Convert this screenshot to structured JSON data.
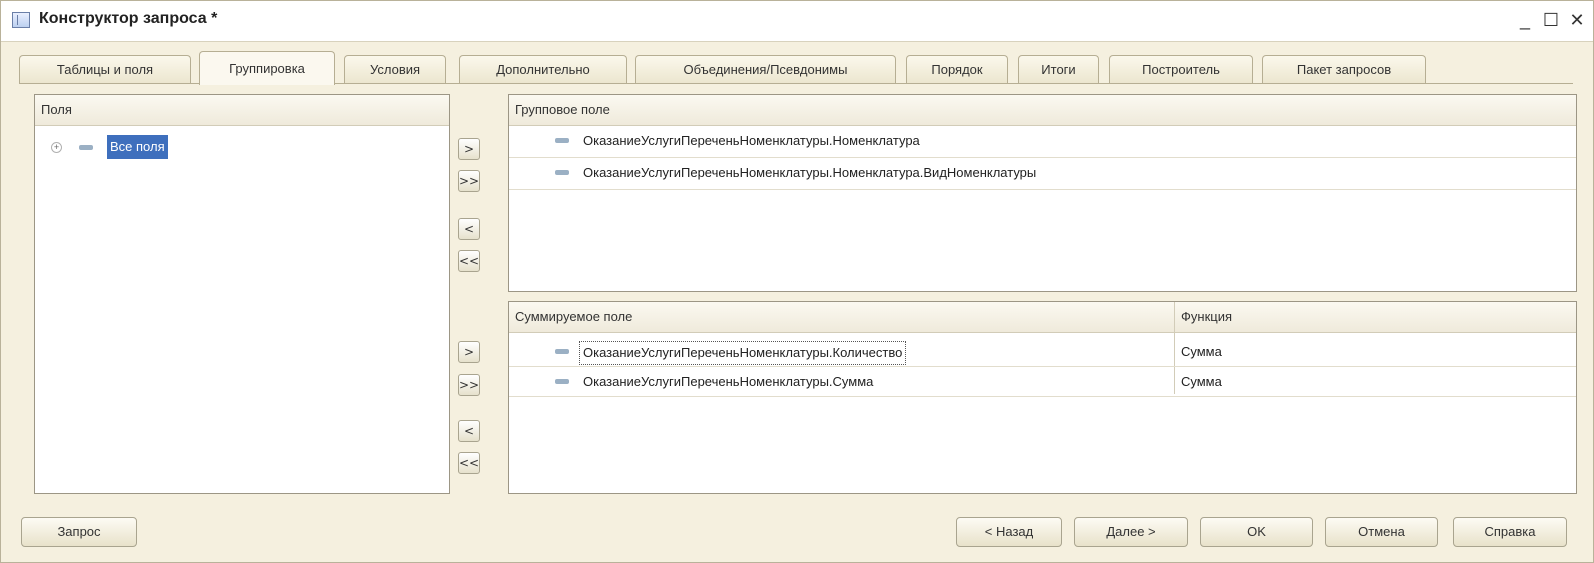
{
  "window": {
    "title": "Конструктор запроса *",
    "minimize_label": "_",
    "maximize_label": "☐",
    "close_label": "✕"
  },
  "tabs": [
    {
      "label": "Таблицы и поля"
    },
    {
      "label": "Группировка",
      "active": true
    },
    {
      "label": "Условия"
    },
    {
      "label": "Дополнительно"
    },
    {
      "label": "Объединения/Псевдонимы"
    },
    {
      "label": "Порядок"
    },
    {
      "label": "Итоги"
    },
    {
      "label": "Построитель"
    },
    {
      "label": "Пакет запросов"
    }
  ],
  "fields_panel": {
    "header": "Поля",
    "tree": [
      {
        "label": "Все поля",
        "expand_glyph": "+",
        "selected": true
      }
    ]
  },
  "group_panel": {
    "header": "Групповое поле",
    "rows": [
      "ОказаниеУслугиПереченьНоменклатуры.Номенклатура",
      "ОказаниеУслугиПереченьНоменклатуры.Номенклатура.ВидНоменклатуры"
    ]
  },
  "sum_panel": {
    "header_field": "Суммируемое поле",
    "header_function": "Функция",
    "rows": [
      {
        "field": "ОказаниеУслугиПереченьНоменклатуры.Количество",
        "function": "Сумма",
        "focused": true
      },
      {
        "field": "ОказаниеУслугиПереченьНоменклатуры.Сумма",
        "function": "Сумма"
      }
    ]
  },
  "move_buttons": {
    "add": ">",
    "add_all": ">>",
    "remove": "<",
    "remove_all": "<<"
  },
  "footer": {
    "query": "Запрос",
    "back": "< Назад",
    "next": "Далее >",
    "ok": "OK",
    "cancel": "Отмена",
    "help": "Справка"
  },
  "icons": {
    "window_icon": "query-window-icon",
    "field_icon": "field-icon",
    "expand_icon": "plus-expand-icon"
  },
  "colors": {
    "window_bg": "#f5f0df",
    "selection": "#3e6fbd"
  }
}
